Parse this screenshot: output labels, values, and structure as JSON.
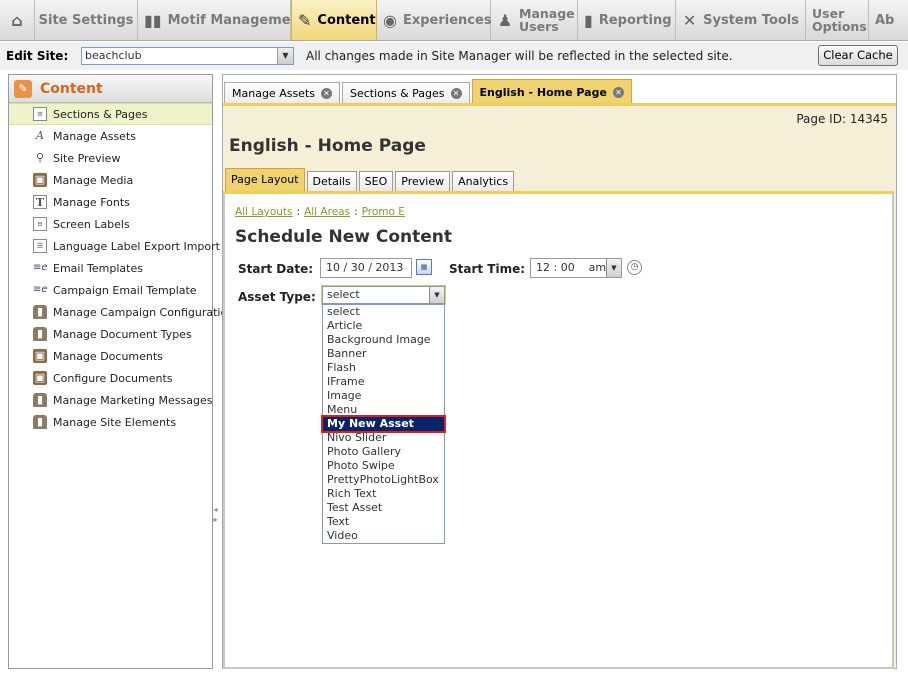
{
  "nav": {
    "items": [
      {
        "label": "",
        "icon": "home-icon",
        "glyph": "⌂"
      },
      {
        "label": "Site Settings",
        "icon": "",
        "glyph": ""
      },
      {
        "label": "Motif Management",
        "icon": "motif-icon",
        "glyph": "▮▮"
      },
      {
        "label": "Content",
        "icon": "content-icon",
        "glyph": "✎"
      },
      {
        "label": "Experiences",
        "icon": "globe-icon",
        "glyph": "◉"
      },
      {
        "label": "Manage Users",
        "icon": "users-icon",
        "glyph": "♟"
      },
      {
        "label": "Reporting",
        "icon": "chart-icon",
        "glyph": "▮"
      },
      {
        "label": "System Tools",
        "icon": "tools-icon",
        "glyph": "✕"
      },
      {
        "label": "User Options",
        "icon": "",
        "glyph": ""
      },
      {
        "label": "Ab",
        "icon": "",
        "glyph": ""
      }
    ],
    "active_index": 3
  },
  "sitebar": {
    "label": "Edit Site:",
    "site_value": "beachclub",
    "message": "All changes made in Site Manager will be reflected in the selected site.",
    "clear_cache": "Clear Cache"
  },
  "sidebar": {
    "title": "Content",
    "items": [
      {
        "label": "Sections & Pages",
        "icon": "page-icon",
        "selected": true
      },
      {
        "label": "Manage Assets",
        "icon": "font-a-icon"
      },
      {
        "label": "Site Preview",
        "icon": "magnifier-icon"
      },
      {
        "label": "Manage Media",
        "icon": "media-icon"
      },
      {
        "label": "Manage Fonts",
        "icon": "font-t-icon"
      },
      {
        "label": "Screen Labels",
        "icon": "page-icon"
      },
      {
        "label": "Language Label Export Import",
        "icon": "list-icon"
      },
      {
        "label": "Email Templates",
        "icon": "email-icon"
      },
      {
        "label": "Campaign Email Template",
        "icon": "email-icon"
      },
      {
        "label": "Manage Campaign Configuration",
        "icon": "can-icon"
      },
      {
        "label": "Manage Document Types",
        "icon": "can-icon"
      },
      {
        "label": "Manage Documents",
        "icon": "media-icon"
      },
      {
        "label": "Configure Documents",
        "icon": "media-icon"
      },
      {
        "label": "Manage Marketing Messages",
        "icon": "can-icon"
      },
      {
        "label": "Manage Site Elements",
        "icon": "can-icon"
      }
    ]
  },
  "page_tabs": [
    {
      "label": "Manage Assets",
      "active": false
    },
    {
      "label": "Sections & Pages",
      "active": false
    },
    {
      "label": "English - Home Page",
      "active": true
    }
  ],
  "page": {
    "page_id": "Page ID: 14345",
    "title": "English - Home Page",
    "subtabs": [
      {
        "label": "Page Layout",
        "active": true
      },
      {
        "label": "Details"
      },
      {
        "label": "SEO"
      },
      {
        "label": "Preview"
      },
      {
        "label": "Analytics"
      }
    ],
    "breadcrumbs": [
      "All Layouts",
      "All Areas",
      "Promo E"
    ],
    "crumb_sep": ":",
    "section_title": "Schedule New Content",
    "start_date_label": "Start Date:",
    "start_date": "10 / 30 /  2013",
    "start_time_label": "Start Time:",
    "start_time": "12 : 00    am",
    "asset_type_label": "Asset Type:",
    "asset_type_value": "select",
    "asset_options": [
      "select",
      "Article",
      "Background Image",
      "Banner",
      "Flash",
      "IFrame",
      "Image",
      "Menu",
      "My New Asset",
      "Nivo Slider",
      "Photo Gallery",
      "Photo Swipe",
      "PrettyPhotoLightBox",
      "Rich Text",
      "Test Asset",
      "Text",
      "Video"
    ],
    "highlighted_option": "My New Asset"
  }
}
